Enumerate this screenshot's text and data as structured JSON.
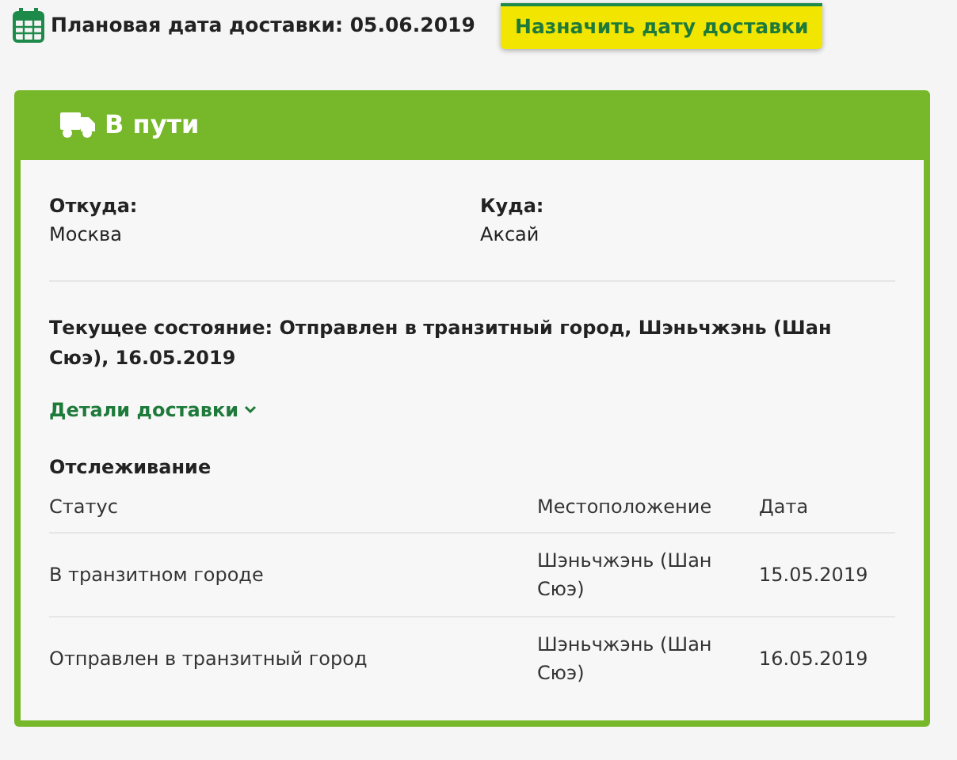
{
  "planned_date": {
    "label": "Плановая дата доставки: 05.06.2019"
  },
  "schedule_button": "Назначить дату доставки",
  "card": {
    "title": "В пути",
    "from": {
      "label": "Откуда:",
      "value": "Москва"
    },
    "to": {
      "label": "Куда:",
      "value": "Аксай"
    },
    "current_state": "Текущее состояние: Отправлен в транзитный город, Шэньчжэнь (Шан Сюэ), 16.05.2019",
    "details_link": {
      "label": "Детали доставки",
      "expanded": false
    },
    "tracking": {
      "title": "Отслеживание",
      "columns": [
        "Статус",
        "Местоположение",
        "Дата"
      ],
      "rows": [
        {
          "status": "В транзитном городе",
          "location": "Шэньчжэнь (Шан Сюэ)",
          "date": "15.05.2019"
        },
        {
          "status": "Отправлен в транзитный город",
          "location": "Шэньчжэнь (Шан Сюэ)",
          "date": "16.05.2019"
        }
      ]
    }
  }
}
